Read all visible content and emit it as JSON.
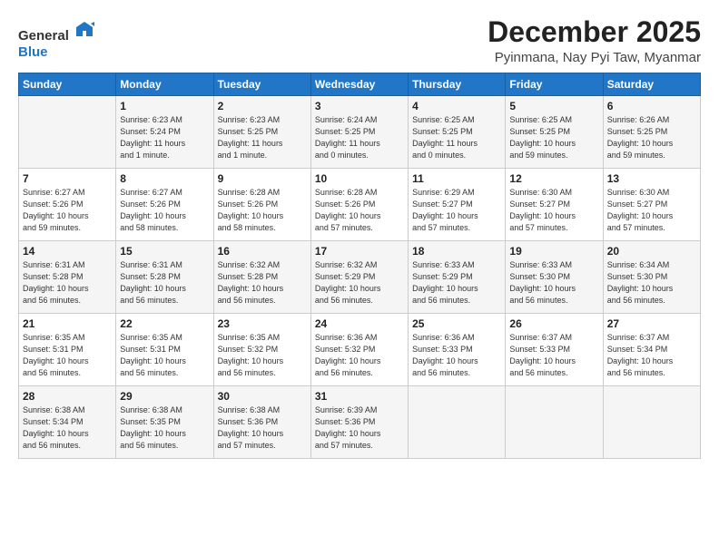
{
  "header": {
    "logo_general": "General",
    "logo_blue": "Blue",
    "title": "December 2025",
    "subtitle": "Pyinmana, Nay Pyi Taw, Myanmar"
  },
  "columns": [
    "Sunday",
    "Monday",
    "Tuesday",
    "Wednesday",
    "Thursday",
    "Friday",
    "Saturday"
  ],
  "weeks": [
    [
      {
        "day": "",
        "info": ""
      },
      {
        "day": "1",
        "info": "Sunrise: 6:23 AM\nSunset: 5:24 PM\nDaylight: 11 hours\nand 1 minute."
      },
      {
        "day": "2",
        "info": "Sunrise: 6:23 AM\nSunset: 5:25 PM\nDaylight: 11 hours\nand 1 minute."
      },
      {
        "day": "3",
        "info": "Sunrise: 6:24 AM\nSunset: 5:25 PM\nDaylight: 11 hours\nand 0 minutes."
      },
      {
        "day": "4",
        "info": "Sunrise: 6:25 AM\nSunset: 5:25 PM\nDaylight: 11 hours\nand 0 minutes."
      },
      {
        "day": "5",
        "info": "Sunrise: 6:25 AM\nSunset: 5:25 PM\nDaylight: 10 hours\nand 59 minutes."
      },
      {
        "day": "6",
        "info": "Sunrise: 6:26 AM\nSunset: 5:25 PM\nDaylight: 10 hours\nand 59 minutes."
      }
    ],
    [
      {
        "day": "7",
        "info": "Sunrise: 6:27 AM\nSunset: 5:26 PM\nDaylight: 10 hours\nand 59 minutes."
      },
      {
        "day": "8",
        "info": "Sunrise: 6:27 AM\nSunset: 5:26 PM\nDaylight: 10 hours\nand 58 minutes."
      },
      {
        "day": "9",
        "info": "Sunrise: 6:28 AM\nSunset: 5:26 PM\nDaylight: 10 hours\nand 58 minutes."
      },
      {
        "day": "10",
        "info": "Sunrise: 6:28 AM\nSunset: 5:26 PM\nDaylight: 10 hours\nand 57 minutes."
      },
      {
        "day": "11",
        "info": "Sunrise: 6:29 AM\nSunset: 5:27 PM\nDaylight: 10 hours\nand 57 minutes."
      },
      {
        "day": "12",
        "info": "Sunrise: 6:30 AM\nSunset: 5:27 PM\nDaylight: 10 hours\nand 57 minutes."
      },
      {
        "day": "13",
        "info": "Sunrise: 6:30 AM\nSunset: 5:27 PM\nDaylight: 10 hours\nand 57 minutes."
      }
    ],
    [
      {
        "day": "14",
        "info": "Sunrise: 6:31 AM\nSunset: 5:28 PM\nDaylight: 10 hours\nand 56 minutes."
      },
      {
        "day": "15",
        "info": "Sunrise: 6:31 AM\nSunset: 5:28 PM\nDaylight: 10 hours\nand 56 minutes."
      },
      {
        "day": "16",
        "info": "Sunrise: 6:32 AM\nSunset: 5:28 PM\nDaylight: 10 hours\nand 56 minutes."
      },
      {
        "day": "17",
        "info": "Sunrise: 6:32 AM\nSunset: 5:29 PM\nDaylight: 10 hours\nand 56 minutes."
      },
      {
        "day": "18",
        "info": "Sunrise: 6:33 AM\nSunset: 5:29 PM\nDaylight: 10 hours\nand 56 minutes."
      },
      {
        "day": "19",
        "info": "Sunrise: 6:33 AM\nSunset: 5:30 PM\nDaylight: 10 hours\nand 56 minutes."
      },
      {
        "day": "20",
        "info": "Sunrise: 6:34 AM\nSunset: 5:30 PM\nDaylight: 10 hours\nand 56 minutes."
      }
    ],
    [
      {
        "day": "21",
        "info": "Sunrise: 6:35 AM\nSunset: 5:31 PM\nDaylight: 10 hours\nand 56 minutes."
      },
      {
        "day": "22",
        "info": "Sunrise: 6:35 AM\nSunset: 5:31 PM\nDaylight: 10 hours\nand 56 minutes."
      },
      {
        "day": "23",
        "info": "Sunrise: 6:35 AM\nSunset: 5:32 PM\nDaylight: 10 hours\nand 56 minutes."
      },
      {
        "day": "24",
        "info": "Sunrise: 6:36 AM\nSunset: 5:32 PM\nDaylight: 10 hours\nand 56 minutes."
      },
      {
        "day": "25",
        "info": "Sunrise: 6:36 AM\nSunset: 5:33 PM\nDaylight: 10 hours\nand 56 minutes."
      },
      {
        "day": "26",
        "info": "Sunrise: 6:37 AM\nSunset: 5:33 PM\nDaylight: 10 hours\nand 56 minutes."
      },
      {
        "day": "27",
        "info": "Sunrise: 6:37 AM\nSunset: 5:34 PM\nDaylight: 10 hours\nand 56 minutes."
      }
    ],
    [
      {
        "day": "28",
        "info": "Sunrise: 6:38 AM\nSunset: 5:34 PM\nDaylight: 10 hours\nand 56 minutes."
      },
      {
        "day": "29",
        "info": "Sunrise: 6:38 AM\nSunset: 5:35 PM\nDaylight: 10 hours\nand 56 minutes."
      },
      {
        "day": "30",
        "info": "Sunrise: 6:38 AM\nSunset: 5:36 PM\nDaylight: 10 hours\nand 57 minutes."
      },
      {
        "day": "31",
        "info": "Sunrise: 6:39 AM\nSunset: 5:36 PM\nDaylight: 10 hours\nand 57 minutes."
      },
      {
        "day": "",
        "info": ""
      },
      {
        "day": "",
        "info": ""
      },
      {
        "day": "",
        "info": ""
      }
    ]
  ]
}
